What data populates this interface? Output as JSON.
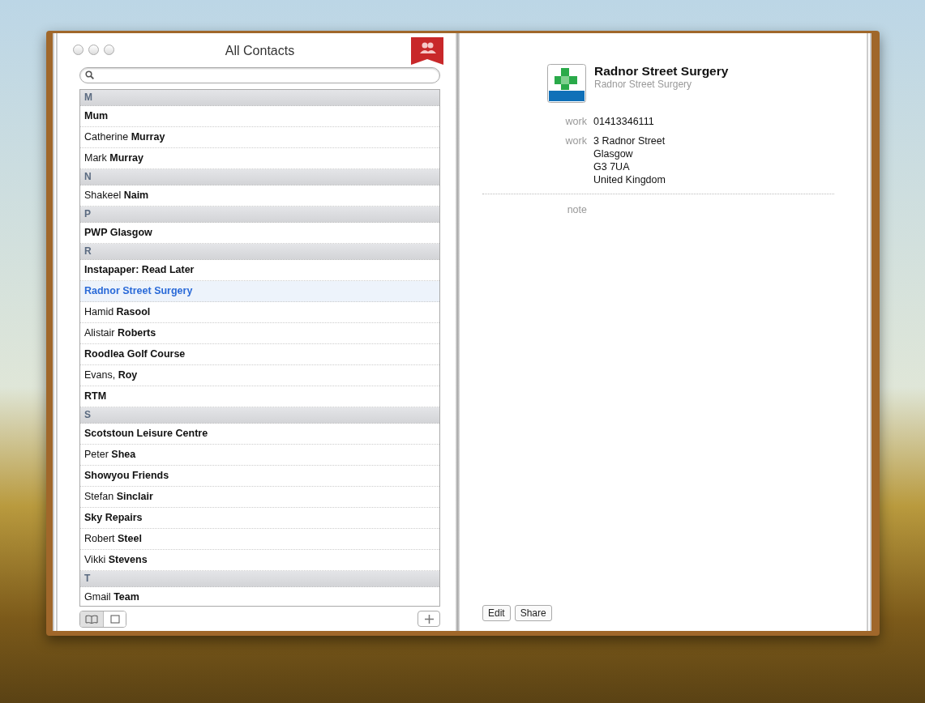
{
  "window": {
    "title": "All Contacts"
  },
  "rows": [
    {
      "kind": "header",
      "label": "M"
    },
    {
      "kind": "company",
      "name": "Mum",
      "selected": false
    },
    {
      "kind": "person",
      "name": "Catherine **Murray**",
      "selected": false
    },
    {
      "kind": "person",
      "name": "Mark **Murray**",
      "selected": false
    },
    {
      "kind": "header",
      "label": "N"
    },
    {
      "kind": "person",
      "name": "Shakeel **Naim**",
      "selected": false
    },
    {
      "kind": "header",
      "label": "P"
    },
    {
      "kind": "company",
      "name": "PWP Glasgow",
      "selected": false
    },
    {
      "kind": "header",
      "label": "R"
    },
    {
      "kind": "company",
      "name": "Instapaper: Read Later",
      "selected": false
    },
    {
      "kind": "company",
      "name": "Radnor Street Surgery",
      "selected": true
    },
    {
      "kind": "person",
      "name": "Hamid **Rasool**",
      "selected": false
    },
    {
      "kind": "person",
      "name": "Alistair **Roberts**",
      "selected": false
    },
    {
      "kind": "company",
      "name": "Roodlea Golf Course",
      "selected": false
    },
    {
      "kind": "person",
      "name": "Evans, **Roy**",
      "selected": false
    },
    {
      "kind": "company",
      "name": "RTM",
      "selected": false
    },
    {
      "kind": "header",
      "label": "S"
    },
    {
      "kind": "company",
      "name": "Scotstoun Leisure Centre",
      "selected": false
    },
    {
      "kind": "person",
      "name": "Peter **Shea**",
      "selected": false
    },
    {
      "kind": "company",
      "name": "Showyou Friends",
      "selected": false
    },
    {
      "kind": "person",
      "name": "Stefan **Sinclair**",
      "selected": false
    },
    {
      "kind": "company",
      "name": "Sky Repairs",
      "selected": false
    },
    {
      "kind": "person",
      "name": "Robert **Steel**",
      "selected": false
    },
    {
      "kind": "person",
      "name": "Vikki **Stevens**",
      "selected": false
    },
    {
      "kind": "header",
      "label": "T"
    },
    {
      "kind": "person",
      "name": "Gmail **Team**",
      "selected": false
    }
  ],
  "view_toggle": [
    {
      "kind": "book",
      "selected": true
    },
    {
      "kind": "card",
      "selected": false
    }
  ],
  "card": {
    "name": "Radnor Street Surgery",
    "company": "Radnor Street Surgery",
    "fields": [
      {
        "label": "work",
        "lines": [
          "01413346111"
        ]
      },
      {
        "label": "work",
        "lines": [
          "3 Radnor Street",
          "Glasgow",
          "G3 7UA",
          "United Kingdom"
        ]
      }
    ],
    "note_label": "note"
  },
  "buttons": [
    "Edit",
    "Share"
  ]
}
